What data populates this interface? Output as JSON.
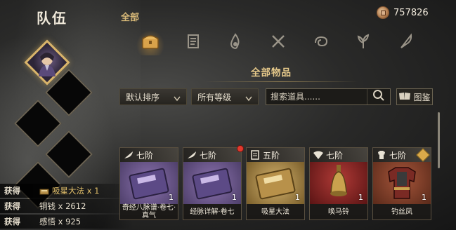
{
  "team": {
    "title": "队伍"
  },
  "gains": [
    {
      "label": "获得",
      "icon": "book-icon",
      "text": "吸星大法 x 1",
      "color": "#e3c06a"
    },
    {
      "label": "获得",
      "icon": "",
      "text": "铜钱 x 2612",
      "color": "#e4dccb"
    },
    {
      "label": "获得",
      "icon": "",
      "text": "感悟 x 925",
      "color": "#e4dccb"
    }
  ],
  "tabs": {
    "all": "全部"
  },
  "currency": {
    "icon": "coin-icon",
    "value": "757826"
  },
  "categories": [
    {
      "icon": "chest-icon",
      "active": true
    },
    {
      "icon": "scroll-icon",
      "active": false
    },
    {
      "icon": "flame-icon",
      "active": false
    },
    {
      "icon": "crossed-blades-icon",
      "active": false
    },
    {
      "icon": "swirl-icon",
      "active": false
    },
    {
      "icon": "herb-icon",
      "active": false
    },
    {
      "icon": "feather-icon",
      "active": false
    }
  ],
  "section_title": "全部物品",
  "filters": {
    "sort": "默认排序",
    "grade": "所有等级",
    "search_placeholder": "搜索道具......",
    "atlas": "图鉴"
  },
  "items": [
    {
      "tier": "七阶",
      "tier_icon": "quill-icon",
      "name": "奇经八脉谱·卷七·真气",
      "count": "1",
      "style": "purple",
      "art": "purple-book-icon",
      "red_dot": false,
      "badge": false
    },
    {
      "tier": "七阶",
      "tier_icon": "quill-icon",
      "name": "经脉详解·卷七",
      "count": "1",
      "style": "purple",
      "art": "purple-book-icon",
      "red_dot": true,
      "badge": false
    },
    {
      "tier": "五阶",
      "tier_icon": "scroll-icon",
      "name": "吸星大法",
      "count": "1",
      "style": "gold",
      "art": "gold-book-icon",
      "red_dot": false,
      "badge": false
    },
    {
      "tier": "七阶",
      "tier_icon": "fan-icon",
      "name": "唤马铃",
      "count": "1",
      "style": "red",
      "art": "bell-icon",
      "red_dot": false,
      "badge": false
    },
    {
      "tier": "七阶",
      "tier_icon": "armor-icon",
      "name": "钓丝凤",
      "count": "1",
      "style": "orange",
      "art": "armor-icon",
      "red_dot": false,
      "badge": true
    }
  ]
}
